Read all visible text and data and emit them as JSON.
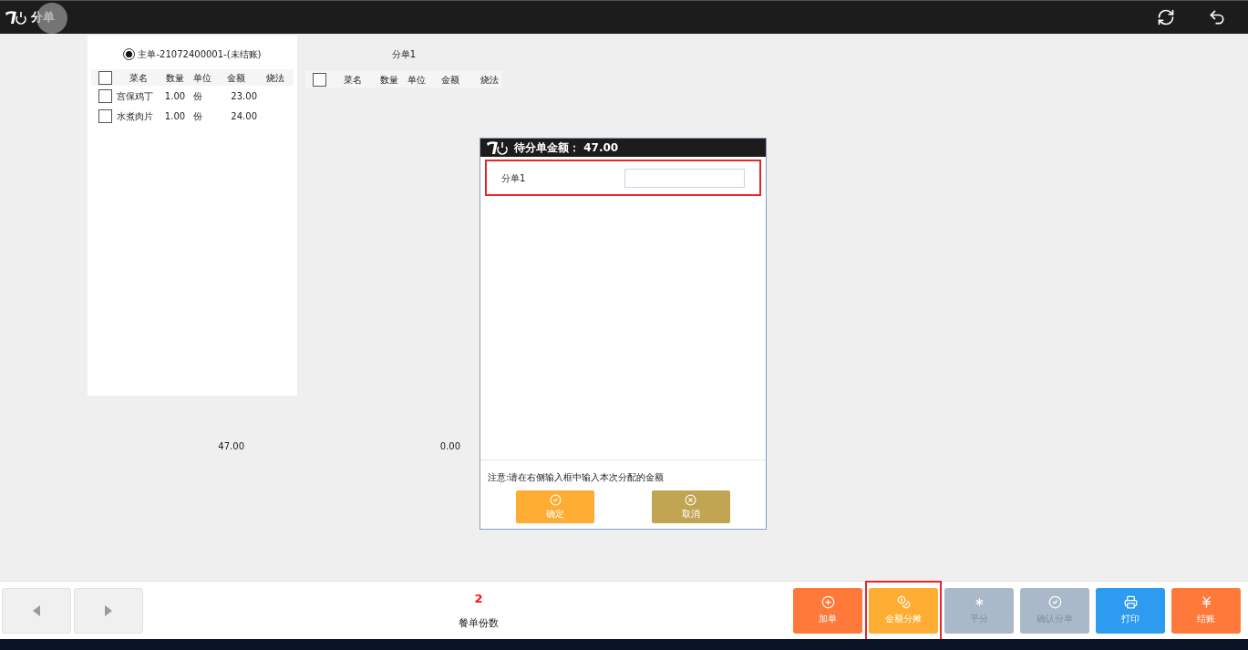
{
  "header": {
    "title": "分单"
  },
  "main_order": {
    "title": "主单-21072400001-(未结账)",
    "selected": true,
    "all_checked": false,
    "columns": [
      "菜名",
      "数量",
      "单位",
      "金额",
      "烧法"
    ],
    "rows": [
      {
        "name": "宫保鸡丁",
        "qty": "1.00",
        "unit": "份",
        "amount": "23.00",
        "checked": false
      },
      {
        "name": "水煮肉片",
        "qty": "1.00",
        "unit": "份",
        "amount": "24.00",
        "checked": false
      }
    ],
    "total": "47.00"
  },
  "sub_order": {
    "title": "分单1",
    "all_checked": false,
    "columns": [
      "菜名",
      "数量",
      "单位",
      "金额",
      "烧法"
    ],
    "total": "0.00"
  },
  "dialog": {
    "title": "待分单金额：",
    "amount": "47.00",
    "rows": [
      {
        "label": "分单1",
        "highlighted": true
      }
    ],
    "note": "注意:请在右侧输入框中输入本次分配的金额",
    "buttons": [
      {
        "label": "确定",
        "color": "#ffac33"
      },
      {
        "label": "取消",
        "color": "#c1a552"
      }
    ]
  },
  "bottom": {
    "count": "2",
    "count_label": "餐单份数",
    "actions": [
      {
        "label": "加单",
        "color": "#ff7a3a",
        "disabled": false,
        "highlighted": false
      },
      {
        "label": "金额分摊",
        "color": "#ffac33",
        "disabled": false,
        "highlighted": true
      },
      {
        "label": "平分",
        "color": "#a9b9c9",
        "disabled": true,
        "highlighted": false
      },
      {
        "label": "确认分单",
        "color": "#a9b9c9",
        "disabled": true,
        "highlighted": false
      },
      {
        "label": "打印",
        "color": "#2d9bf0",
        "disabled": false,
        "highlighted": false
      },
      {
        "label": "结账",
        "color": "#ff7a3a",
        "disabled": false,
        "highlighted": false
      }
    ]
  }
}
